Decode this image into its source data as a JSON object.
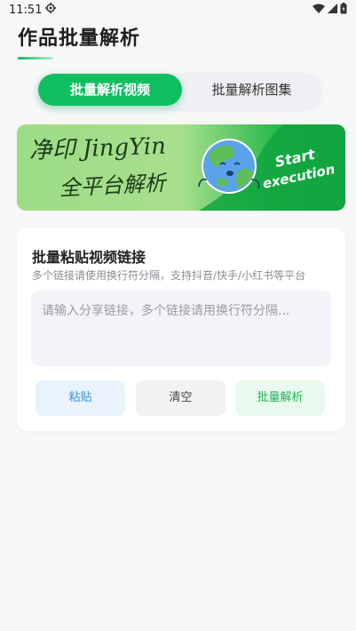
{
  "status_bar": {
    "time": "11:51",
    "icons": [
      "settings-icon",
      "wifi-icon",
      "signal-icon",
      "battery-icon"
    ]
  },
  "header": {
    "title": "作品批量解析"
  },
  "tabs": [
    {
      "label": "批量解析视频",
      "active": true
    },
    {
      "label": "批量解析图集",
      "active": false
    }
  ],
  "banner": {
    "line1": "净印 JingYin",
    "line2": "全平台解析",
    "cta_line1": "Start",
    "cta_line2": "execution"
  },
  "paste_card": {
    "title": "批量粘贴视频链接",
    "subtitle": "多个链接请使用换行符分隔，支持抖音/快手/小红书等平台",
    "input_value": "",
    "input_placeholder": "请输入分享链接，多个链接请用换行符分隔...",
    "paste_label": "粘贴",
    "clear_label": "清空",
    "parse_label": "批量解析"
  },
  "colors": {
    "accent": "#0fbf60",
    "background": "#f6f7f9",
    "paste_blue": "#3a8fe0",
    "parse_green": "#1eb55c"
  }
}
